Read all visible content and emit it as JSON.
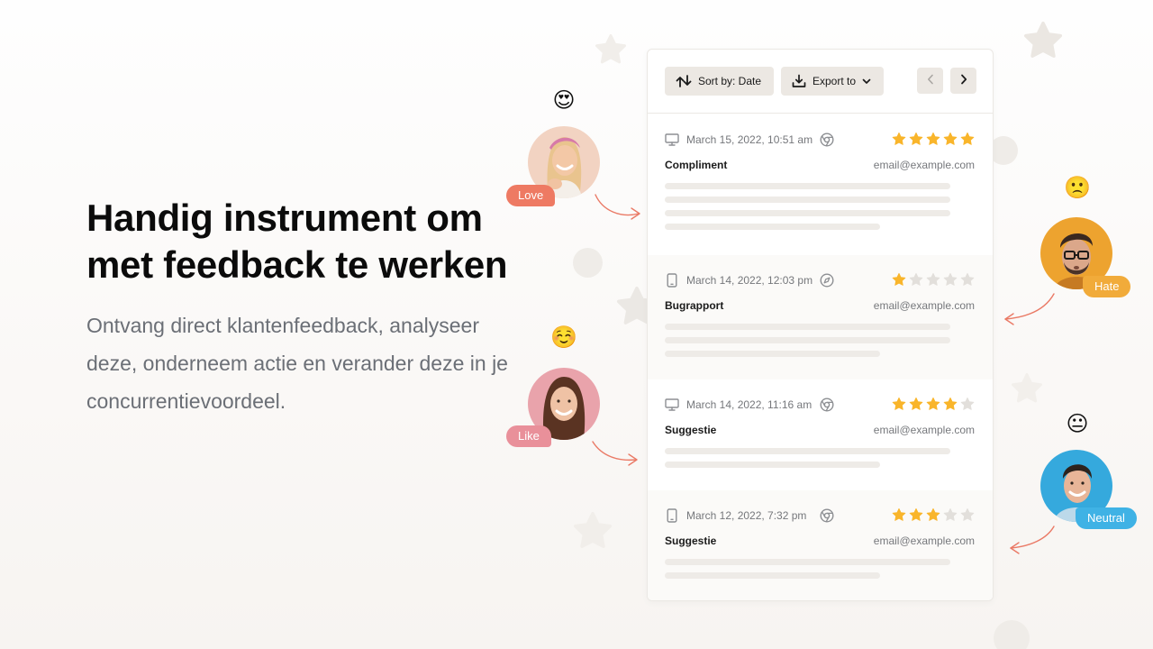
{
  "hero": {
    "title": "Handig instrument om met feedback te werken",
    "body": "Ontvang direct klantenfeedback, analyseer deze, onderneem actie en verander deze in je concurrentievoordeel."
  },
  "toolbar": {
    "sort_label": "Sort by: Date",
    "export_label": "Export to",
    "prev_icon": "chevron-left-icon",
    "next_icon": "chevron-right-icon"
  },
  "feedback": [
    {
      "device": "desktop",
      "date": "March 15, 2022, 10:51 am",
      "browser": "chrome",
      "rating": 5,
      "max_rating": 5,
      "type": "Compliment",
      "email": "email@example.com",
      "line_count": 4
    },
    {
      "device": "mobile",
      "date": "March 14, 2022, 12:03 pm",
      "browser": "safari",
      "rating": 1,
      "max_rating": 5,
      "type": "Bugrapport",
      "email": "email@example.com",
      "line_count": 3
    },
    {
      "device": "desktop",
      "date": "March 14, 2022, 11:16 am",
      "browser": "chrome",
      "rating": 4,
      "max_rating": 5,
      "type": "Suggestie",
      "email": "email@example.com",
      "line_count": 2
    },
    {
      "device": "mobile",
      "date": "March 12, 2022, 7:32 pm",
      "browser": "chrome",
      "rating": 3,
      "max_rating": 5,
      "type": "Suggestie",
      "email": "email@example.com",
      "line_count": 2
    }
  ],
  "reactions": [
    {
      "emoji": "😍",
      "label": "Love",
      "color": "#ee7a63",
      "avatar_bg": "#f2d3c2"
    },
    {
      "emoji": "☺️",
      "label": "Like",
      "color": "#e9909a",
      "avatar_bg": "#e9a3ab"
    },
    {
      "emoji": "🙁",
      "label": "Hate",
      "color": "#f1ab3a",
      "avatar_bg": "#eda32f"
    },
    {
      "emoji": "😐",
      "label": "Neutral",
      "color": "#3fb2e5",
      "avatar_bg": "#35a9dd"
    }
  ],
  "colors": {
    "star_filled": "#f9b52b",
    "star_empty": "#e2dfdb",
    "arrow": "#ea7a66"
  }
}
